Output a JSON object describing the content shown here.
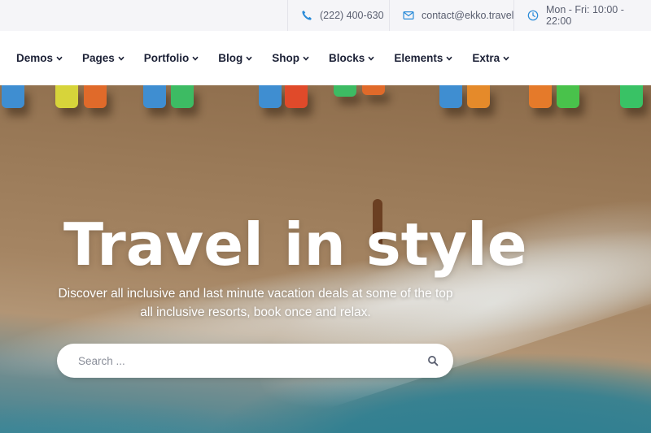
{
  "topbar": {
    "phone": "(222) 400-630",
    "email": "contact@ekko.travel",
    "hours": "Mon - Fri: 10:00 - 22:00",
    "icon_color": "#2a8bd8"
  },
  "nav": {
    "items": [
      {
        "label": "Demos"
      },
      {
        "label": "Pages"
      },
      {
        "label": "Portfolio"
      },
      {
        "label": "Blog"
      },
      {
        "label": "Shop"
      },
      {
        "label": "Blocks"
      },
      {
        "label": "Elements"
      },
      {
        "label": "Extra"
      }
    ]
  },
  "hero": {
    "title": "Travel in style",
    "subtitle": "Discover all inclusive and last minute vacation deals at some of the top all inclusive resorts, book once and relax.",
    "search_placeholder": "Search ...",
    "icons": {
      "search": "search-icon"
    }
  }
}
